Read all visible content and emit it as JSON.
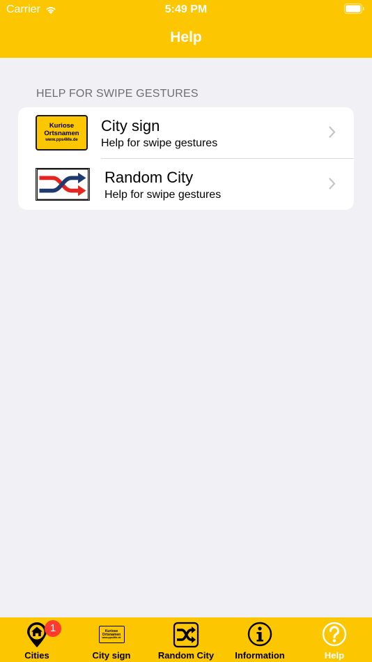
{
  "status_bar": {
    "carrier": "Carrier",
    "time": "5:49 PM"
  },
  "nav": {
    "title": "Help"
  },
  "section": {
    "header": "HELP FOR SWIPE GESTURES",
    "rows": [
      {
        "title": "City sign",
        "subtitle": "Help for swipe gestures",
        "icon": "city-sign-thumbnail"
      },
      {
        "title": "Random City",
        "subtitle": "Help for swipe gestures",
        "icon": "shuffle-thumbnail"
      }
    ]
  },
  "city_sign": {
    "line1": "Kuriose",
    "line2": "Ortsnamen",
    "line3": "www.pps4Me.de"
  },
  "tabbar": {
    "tabs": [
      {
        "label": "Cities",
        "icon": "home-pin-icon",
        "badge": "1"
      },
      {
        "label": "City sign",
        "icon": "city-sign-icon"
      },
      {
        "label": "Random City",
        "icon": "shuffle-icon"
      },
      {
        "label": "Information",
        "icon": "info-icon"
      },
      {
        "label": "Help",
        "icon": "help-icon",
        "active": true
      }
    ]
  },
  "colors": {
    "brand_yellow": "#fcc600",
    "background": "#f0f0f5",
    "badge_red": "#ff3b30",
    "shuffle_blue": "#1f3a6d",
    "shuffle_red": "#e3261f"
  }
}
